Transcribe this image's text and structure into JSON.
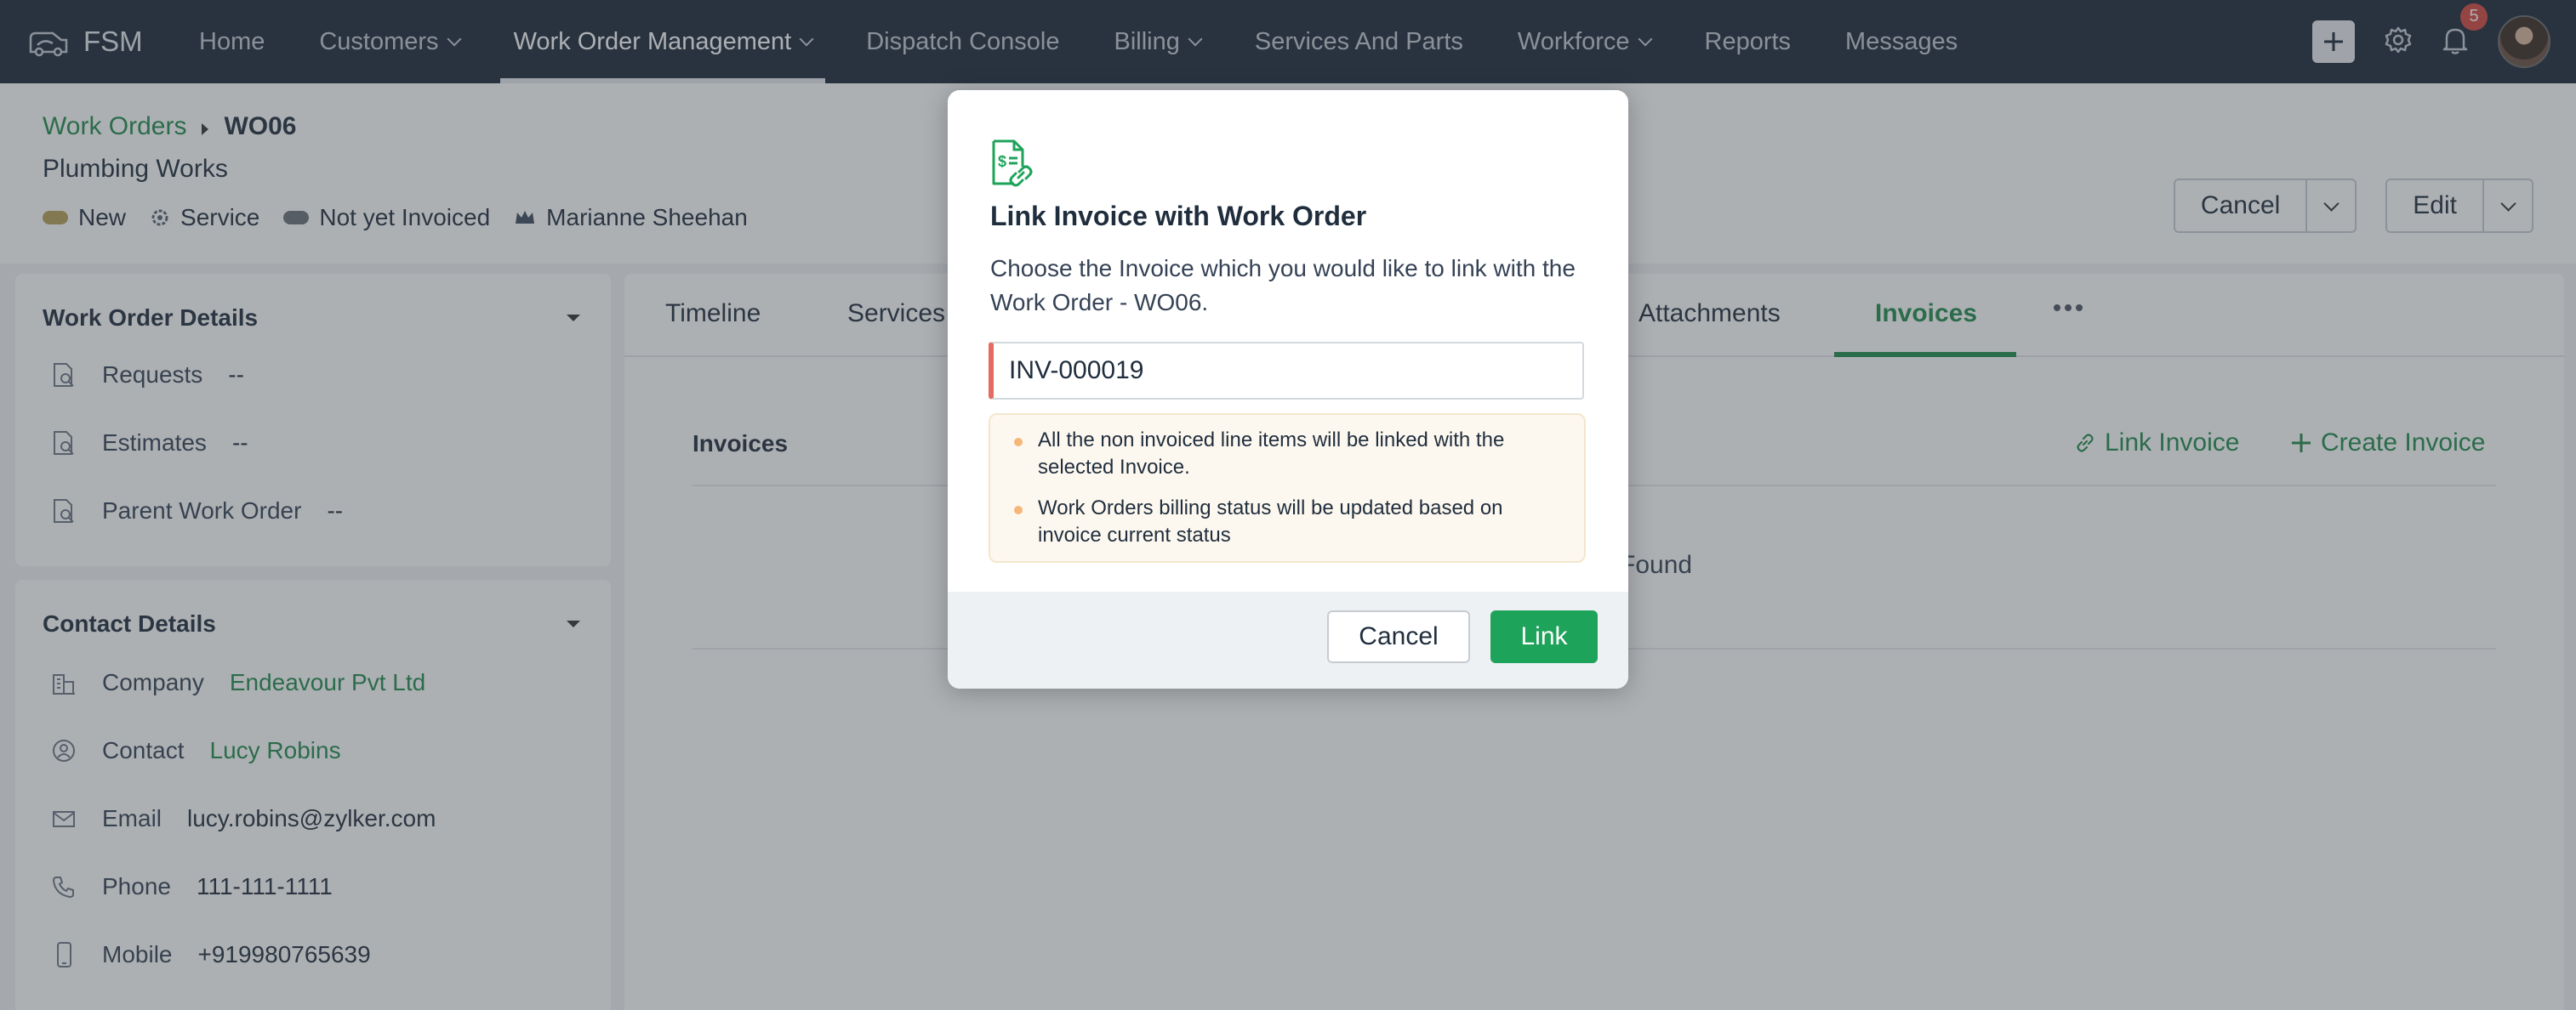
{
  "nav": {
    "brand": "FSM",
    "items": [
      {
        "label": "Home",
        "dropdown": false
      },
      {
        "label": "Customers",
        "dropdown": true
      },
      {
        "label": "Work Order Management",
        "dropdown": true
      },
      {
        "label": "Dispatch Console",
        "dropdown": false
      },
      {
        "label": "Billing",
        "dropdown": true
      },
      {
        "label": "Services And Parts",
        "dropdown": false
      },
      {
        "label": "Workforce",
        "dropdown": true
      },
      {
        "label": "Reports",
        "dropdown": false
      },
      {
        "label": "Messages",
        "dropdown": false
      }
    ],
    "active_index": 2,
    "notification_count": "5"
  },
  "header": {
    "breadcrumb_parent": "Work Orders",
    "breadcrumb_current": "WO06",
    "subtitle": "Plumbing Works",
    "tags": [
      {
        "label": "New",
        "color": "#b5a15a"
      },
      {
        "label": "Service",
        "icon": "gear-icon"
      },
      {
        "label": "Not yet Invoiced",
        "color": "#6b7078"
      },
      {
        "label": "Marianne Sheehan",
        "icon": "crown-icon"
      }
    ],
    "cancel_label": "Cancel",
    "edit_label": "Edit"
  },
  "work_order_details": {
    "title": "Work Order Details",
    "rows": [
      {
        "label": "Requests",
        "value": "--"
      },
      {
        "label": "Estimates",
        "value": "--"
      },
      {
        "label": "Parent Work Order",
        "value": "--"
      }
    ]
  },
  "contact_details": {
    "title": "Contact Details",
    "rows": [
      {
        "label": "Company",
        "value": "Endeavour Pvt Ltd",
        "icon": "building-icon"
      },
      {
        "label": "Contact",
        "value": "Lucy Robins",
        "icon": "user-circle-icon"
      },
      {
        "label": "Email",
        "value": "lucy.robins@zylker.com",
        "icon": "mail-icon"
      },
      {
        "label": "Phone",
        "value": "111-111-1111",
        "icon": "phone-icon"
      },
      {
        "label": "Mobile",
        "value": "+919980765639",
        "icon": "mobile-icon"
      }
    ]
  },
  "tabs": {
    "items": [
      "Timeline",
      "Services",
      "Attachments",
      "Invoices"
    ],
    "active": "Invoices"
  },
  "invoices_section": {
    "title": "Invoices",
    "link_invoice": "Link Invoice",
    "create_invoice": "Create Invoice",
    "empty_text": "Found"
  },
  "modal": {
    "title": "Link Invoice with Work Order",
    "description": "Choose the Invoice which you would like to link with the Work Order - WO06.",
    "input_value": "INV-000019",
    "notes": [
      "All the non invoiced line items will be linked with the selected Invoice.",
      "Work Orders billing status will be updated based on invoice current status"
    ],
    "cancel_label": "Cancel",
    "link_label": "Link"
  },
  "colors": {
    "nav_bg": "#1d2839",
    "accent_green": "#1f8a4c",
    "link_button": "#1ea35a",
    "input_error_border": "#e56b62"
  }
}
